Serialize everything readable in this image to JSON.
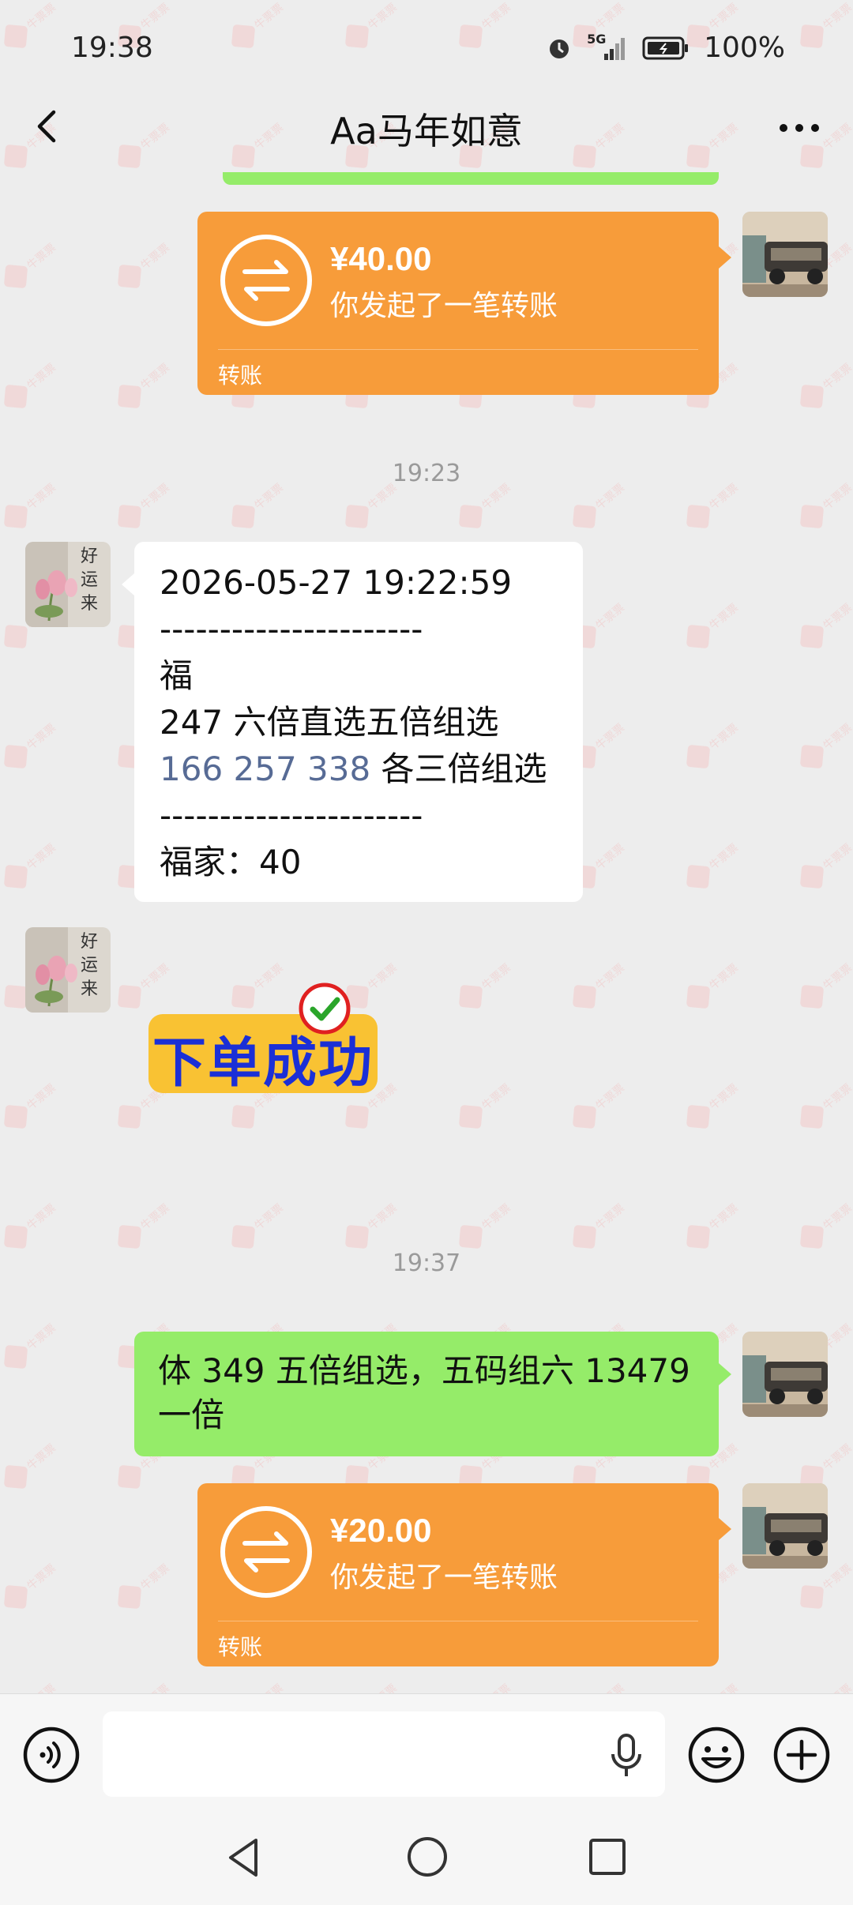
{
  "status_bar": {
    "time": "19:38",
    "network": "5G",
    "battery": "100%"
  },
  "header": {
    "title": "Aa马年如意"
  },
  "messages": {
    "transfer_1": {
      "amount": "¥40.00",
      "description": "你发起了一笔转账",
      "label": "转账"
    },
    "time_1": "19:23",
    "order_text": {
      "line1": "2026-05-27 19:22:59",
      "separator1": "----------------------",
      "line2": "福",
      "line3": "247 六倍直选五倍组选",
      "line4_numbers": "166 257 338",
      "line4_rest": " 各三倍组选",
      "separator2": "----------------------",
      "line5": "福家：40"
    },
    "sticker": {
      "text": "下单成功"
    },
    "time_2": "19:37",
    "green_text": "体 349 五倍组选，五码组六 13479 一倍",
    "transfer_2": {
      "amount": "¥20.00",
      "description": "你发起了一笔转账",
      "label": "转账"
    }
  },
  "left_avatar_text": "好运来",
  "input_bar": {
    "placeholder": ""
  },
  "colors": {
    "chat_bg": "#ededed",
    "transfer_orange": "#f79c3a",
    "sent_green": "#95ec69",
    "link_blue": "#576b95",
    "sticker_yellow": "#f9c233",
    "sticker_blue": "#1b2fd6"
  }
}
